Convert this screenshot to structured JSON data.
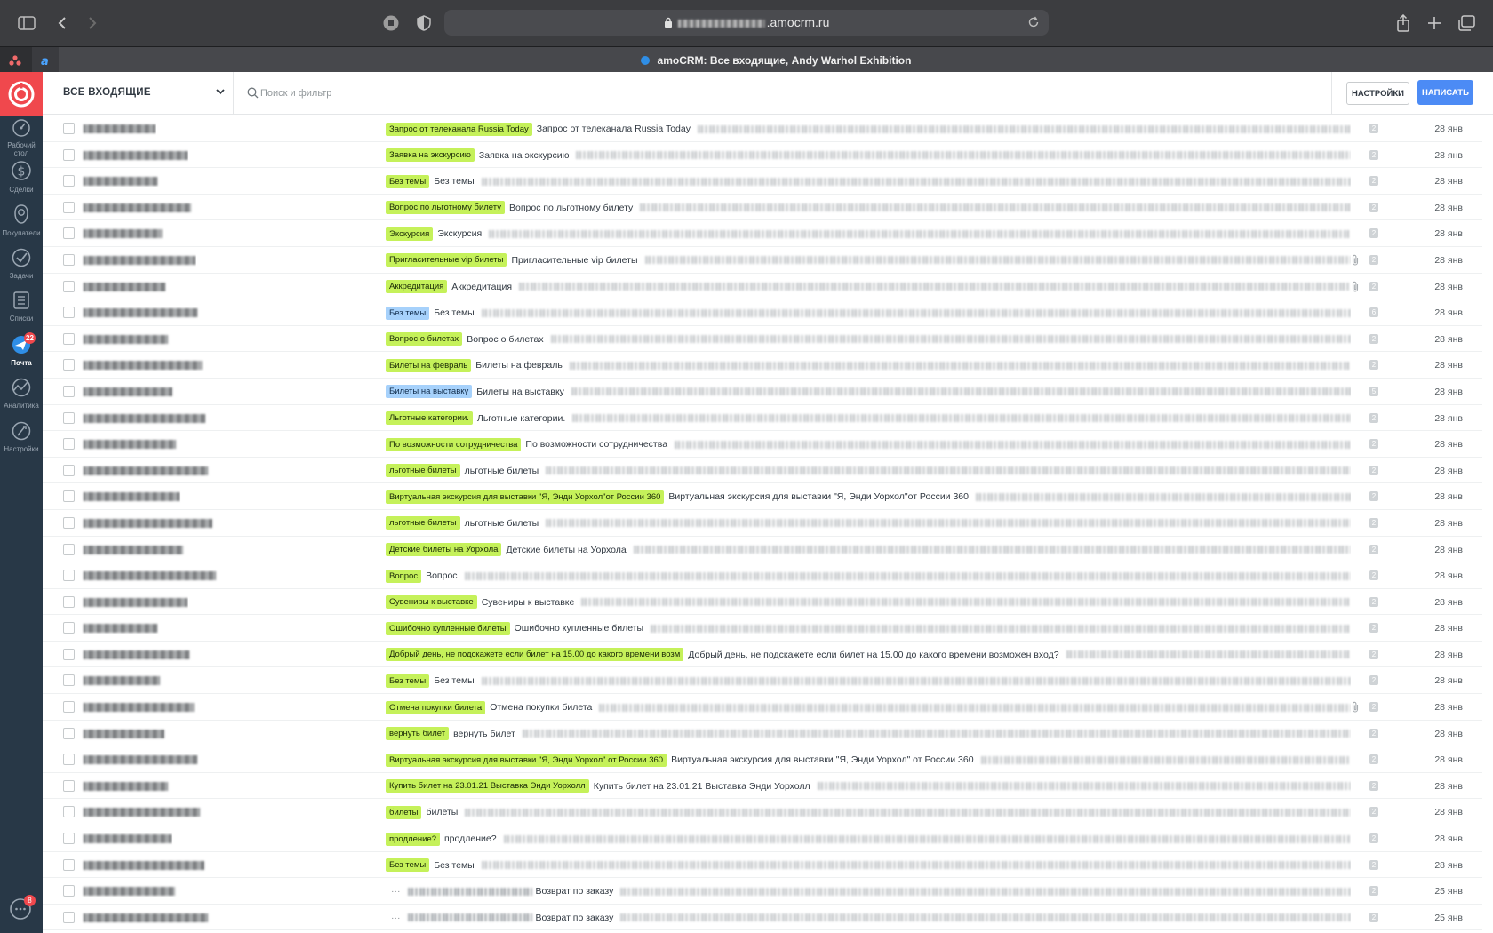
{
  "browser": {
    "url": ".amocrm.ru",
    "tab_title": "amoCRM: Все входящие, Andy Warhol Exhibition"
  },
  "sidebar": {
    "items": [
      {
        "label": "Рабочий стол",
        "icon": "dashboard-icon"
      },
      {
        "label": "Сделки",
        "icon": "dollar-icon"
      },
      {
        "label": "Покупатели",
        "icon": "customers-icon"
      },
      {
        "label": "Задачи",
        "icon": "check-icon"
      },
      {
        "label": "Списки",
        "icon": "lists-icon"
      },
      {
        "label": "Почта",
        "icon": "mail-icon",
        "badge": "22",
        "active": true
      },
      {
        "label": "Аналитика",
        "icon": "analytics-icon"
      },
      {
        "label": "Настройки",
        "icon": "settings-icon"
      }
    ],
    "chat_badge": "8"
  },
  "header": {
    "inbox_label": "ВСЕ ВХОДЯЩИЕ",
    "search_placeholder": "Поиск и фильтр",
    "settings_label": "НАСТРОЙКИ",
    "compose_label": "НАПИСАТЬ"
  },
  "messages": [
    {
      "tag": "Запрос от телеканала Russia Today",
      "subject": "Запрос от телеканала Russia Today",
      "count": "2",
      "date": "28 янв"
    },
    {
      "tag": "Заявка на экскурсию",
      "subject": "Заявка на экскурсию",
      "count": "2",
      "date": "28 янв"
    },
    {
      "tag": "Без темы",
      "subject": "Без темы",
      "count": "2",
      "date": "28 янв"
    },
    {
      "tag": "Вопрос по льготному билету",
      "subject": "Вопрос по льготному билету",
      "count": "2",
      "date": "28 янв"
    },
    {
      "tag": "Экскурсия",
      "subject": "Экскурсия",
      "count": "2",
      "date": "28 янв"
    },
    {
      "tag": "Пригласительные vip билеты",
      "subject": "Пригласительные vip билеты",
      "count": "2",
      "date": "28 янв",
      "attach": true
    },
    {
      "tag": "Аккредитация",
      "subject": "Аккредитация",
      "count": "2",
      "date": "28 янв",
      "attach": true
    },
    {
      "tag": "Без темы",
      "tag_color": "blue",
      "subject": "Без темы",
      "count": "6",
      "date": "28 янв"
    },
    {
      "tag": "Вопрос о билетах",
      "subject": "Вопрос о билетах",
      "count": "2",
      "date": "28 янв"
    },
    {
      "tag": "Билеты на февраль",
      "subject": "Билеты на февраль",
      "count": "2",
      "date": "28 янв"
    },
    {
      "tag": "Билеты на выставку",
      "tag_color": "blue",
      "subject": "Билеты на выставку",
      "count": "5",
      "date": "28 янв"
    },
    {
      "tag": "Льготные категории.",
      "subject": "Льготные категории.",
      "count": "2",
      "date": "28 янв"
    },
    {
      "tag": "По возможности сотрудничества",
      "subject": "По возможности сотрудничества",
      "count": "2",
      "date": "28 янв"
    },
    {
      "tag": "льготные билеты",
      "subject": "льготные билеты",
      "count": "2",
      "date": "28 янв"
    },
    {
      "tag": "Виртуальная экскурсия для выставки \"Я, Энди Уорхол\"от России 360",
      "subject": "Виртуальная экскурсия для выставки \"Я, Энди Уорхол\"от России 360",
      "count": "2",
      "date": "28 янв"
    },
    {
      "tag": "льготные билеты",
      "subject": "льготные билеты",
      "count": "2",
      "date": "28 янв"
    },
    {
      "tag": "Детские билеты на Уорхола",
      "subject": "Детские билеты на Уорхола",
      "count": "2",
      "date": "28 янв"
    },
    {
      "tag": "Вопрос",
      "subject": "Вопрос",
      "count": "2",
      "date": "28 янв"
    },
    {
      "tag": "Сувениры к выставке",
      "subject": "Сувениры к выставке",
      "count": "2",
      "date": "28 янв"
    },
    {
      "tag": "Ошибочно купленные билеты",
      "subject": "Ошибочно купленные билеты",
      "count": "2",
      "date": "28 янв"
    },
    {
      "tag": "Добрый день, не подскажете если билет на 15.00 до какого времени возм",
      "subject": "Добрый день, не подскажете если билет на 15.00 до какого времени возможен вход?",
      "count": "2",
      "date": "28 янв"
    },
    {
      "tag": "Без темы",
      "subject": "Без темы",
      "count": "2",
      "date": "28 янв"
    },
    {
      "tag": "Отмена покупки билета",
      "subject": "Отмена покупки билета",
      "count": "2",
      "date": "28 янв",
      "attach": true
    },
    {
      "tag": "вернуть билет",
      "subject": "вернуть билет",
      "count": "2",
      "date": "28 янв"
    },
    {
      "tag": "Виртуальная экскурсия для выставки \"Я, Энди Уорхол\" от России 360",
      "subject": "Виртуальная экскурсия для выставки \"Я, Энди Уорхол\" от России 360",
      "count": "2",
      "date": "28 янв"
    },
    {
      "tag": "Купить билет на 23.01.21 Выставка Энди Уорхолл",
      "subject": "Купить билет на 23.01.21 Выставка Энди Уорхолл",
      "count": "2",
      "date": "28 янв"
    },
    {
      "tag": "билеты",
      "subject": "билеты",
      "count": "2",
      "date": "28 янв"
    },
    {
      "tag": "продление?",
      "subject": "продление?",
      "count": "2",
      "date": "28 янв"
    },
    {
      "tag": "Без темы",
      "subject": "Без темы",
      "count": "2",
      "date": "28 янв"
    },
    {
      "tag": "",
      "ellipsis": "···",
      "subject": "Возврат по заказу",
      "count": "2",
      "date": "25 янв"
    },
    {
      "tag": "",
      "ellipsis": "···",
      "subject": "Возврат по заказу",
      "count": "2",
      "date": "25 янв"
    }
  ]
}
